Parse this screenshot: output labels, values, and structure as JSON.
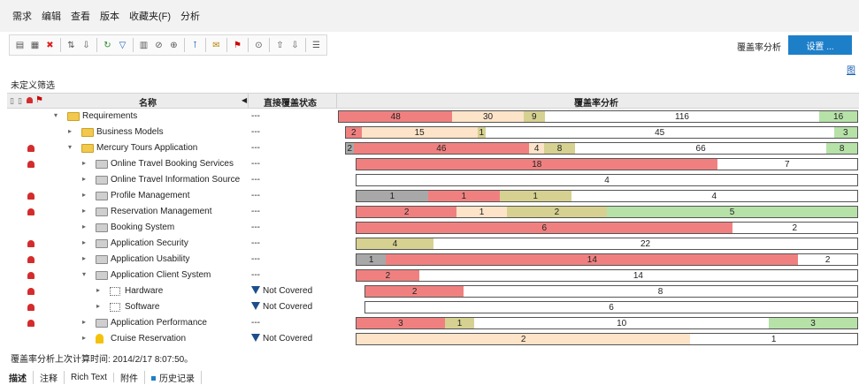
{
  "menu": [
    "需求",
    "编辑",
    "查看",
    "版本",
    "收藏夹(F)",
    "分析"
  ],
  "toolbar": {
    "icons": [
      "new-folder-icon",
      "new-requirement-icon",
      "delete-icon",
      "convert-icon",
      "move-icon",
      "refresh-icon",
      "filter-icon",
      "columns-icon",
      "attachment-icon",
      "zoom-icon",
      "pin-icon",
      "mail-icon",
      "flag-icon",
      "search-icon",
      "up-icon",
      "down-icon",
      "notes-icon"
    ],
    "coverage_label": "覆盖率分析",
    "setup_label": "设置 ..."
  },
  "side_link": "图",
  "filter_label": "未定义筛选",
  "columns": {
    "name": "名称",
    "status": "直接覆盖状态",
    "coverage": "覆盖率分析"
  },
  "colors": {
    "red": "#f08080",
    "peach": "#fde3c8",
    "olive": "#d6d190",
    "green": "#b6e2a8",
    "gray": "#a8a8a8",
    "white": "#ffffff"
  },
  "rows": [
    {
      "name": "Requirements",
      "level": 0,
      "expanded": true,
      "icon": "folder-icon",
      "alert": false,
      "status": "---",
      "bar": [
        {
          "c": "red",
          "v": 48
        },
        {
          "c": "peach",
          "v": 30
        },
        {
          "c": "olive",
          "v": 9
        },
        {
          "c": "white",
          "v": 116
        },
        {
          "c": "green",
          "v": 16
        }
      ]
    },
    {
      "name": "Business Models",
      "level": 1,
      "expanded": false,
      "icon": "folder-icon",
      "alert": false,
      "status": "---",
      "bar": [
        {
          "c": "red",
          "v": 2
        },
        {
          "c": "peach",
          "v": 15
        },
        {
          "c": "olive",
          "v": 1
        },
        {
          "c": "white",
          "v": 45
        },
        {
          "c": "green",
          "v": 3
        }
      ]
    },
    {
      "name": "Mercury Tours Application",
      "level": 1,
      "expanded": true,
      "icon": "folder-icon",
      "alert": true,
      "status": "---",
      "bar": [
        {
          "c": "gray",
          "v": 2
        },
        {
          "c": "red",
          "v": 46
        },
        {
          "c": "peach",
          "v": 4
        },
        {
          "c": "olive",
          "v": 8
        },
        {
          "c": "white",
          "v": 66
        },
        {
          "c": "green",
          "v": 8
        }
      ]
    },
    {
      "name": "Online Travel Booking Services",
      "level": 2,
      "expanded": false,
      "icon": "folder-gray-icon",
      "alert": true,
      "status": "---",
      "bar": [
        {
          "c": "red",
          "v": 18
        },
        {
          "c": "white",
          "v": 7
        }
      ]
    },
    {
      "name": "Online Travel Information Source",
      "level": 2,
      "expanded": false,
      "icon": "folder-gray-icon",
      "alert": false,
      "status": "---",
      "bar": [
        {
          "c": "white",
          "v": 4
        }
      ]
    },
    {
      "name": "Profile Management",
      "level": 2,
      "expanded": false,
      "icon": "folder-gray-icon",
      "alert": true,
      "status": "---",
      "bar": [
        {
          "c": "gray",
          "v": 1
        },
        {
          "c": "red",
          "v": 1
        },
        {
          "c": "olive",
          "v": 1
        },
        {
          "c": "white",
          "v": 4
        }
      ]
    },
    {
      "name": "Reservation Management",
      "level": 2,
      "expanded": false,
      "icon": "folder-gray-icon",
      "alert": true,
      "status": "---",
      "bar": [
        {
          "c": "red",
          "v": 2
        },
        {
          "c": "peach",
          "v": 1
        },
        {
          "c": "olive",
          "v": 2
        },
        {
          "c": "green",
          "v": 5
        }
      ]
    },
    {
      "name": "Booking System",
      "level": 2,
      "expanded": false,
      "icon": "folder-gray-icon",
      "alert": false,
      "status": "---",
      "bar": [
        {
          "c": "red",
          "v": 6
        },
        {
          "c": "white",
          "v": 2
        }
      ]
    },
    {
      "name": "Application Security",
      "level": 2,
      "expanded": false,
      "icon": "folder-gray-icon",
      "alert": true,
      "status": "---",
      "bar": [
        {
          "c": "olive",
          "v": 4
        },
        {
          "c": "white",
          "v": 22
        }
      ]
    },
    {
      "name": "Application Usability",
      "level": 2,
      "expanded": false,
      "icon": "folder-gray-icon",
      "alert": true,
      "status": "---",
      "bar": [
        {
          "c": "gray",
          "v": 1
        },
        {
          "c": "red",
          "v": 14
        },
        {
          "c": "white",
          "v": 2
        }
      ]
    },
    {
      "name": "Application Client System",
      "level": 2,
      "expanded": true,
      "icon": "folder-gray-icon",
      "alert": true,
      "status": "---",
      "bar": [
        {
          "c": "red",
          "v": 2
        },
        {
          "c": "white",
          "v": 14
        }
      ]
    },
    {
      "name": "Hardware",
      "level": 3,
      "expanded": false,
      "icon": "component-icon",
      "alert": true,
      "status": "Not Covered",
      "bar": [
        {
          "c": "red",
          "v": 2
        },
        {
          "c": "white",
          "v": 8
        }
      ]
    },
    {
      "name": "Software",
      "level": 3,
      "expanded": false,
      "icon": "component-icon",
      "alert": true,
      "status": "Not Covered",
      "bar": [
        {
          "c": "white",
          "v": 6
        }
      ]
    },
    {
      "name": "Application Performance",
      "level": 2,
      "expanded": false,
      "icon": "folder-gray-icon",
      "alert": true,
      "status": "---",
      "bar": [
        {
          "c": "red",
          "v": 3
        },
        {
          "c": "olive",
          "v": 1
        },
        {
          "c": "white",
          "v": 10
        },
        {
          "c": "green",
          "v": 3
        }
      ]
    },
    {
      "name": "Cruise Reservation",
      "level": 2,
      "expanded": false,
      "icon": "lightbulb-icon",
      "alert": false,
      "status": "Not Covered",
      "bar": [
        {
          "c": "peach",
          "v": 2
        },
        {
          "c": "white",
          "v": 1
        }
      ]
    }
  ],
  "calc_time": "覆盖率分析上次计算时间: 2014/2/17 8:07:50。",
  "tabs": [
    "描述",
    "注释",
    "Rich Text",
    "附件",
    "历史记录"
  ]
}
